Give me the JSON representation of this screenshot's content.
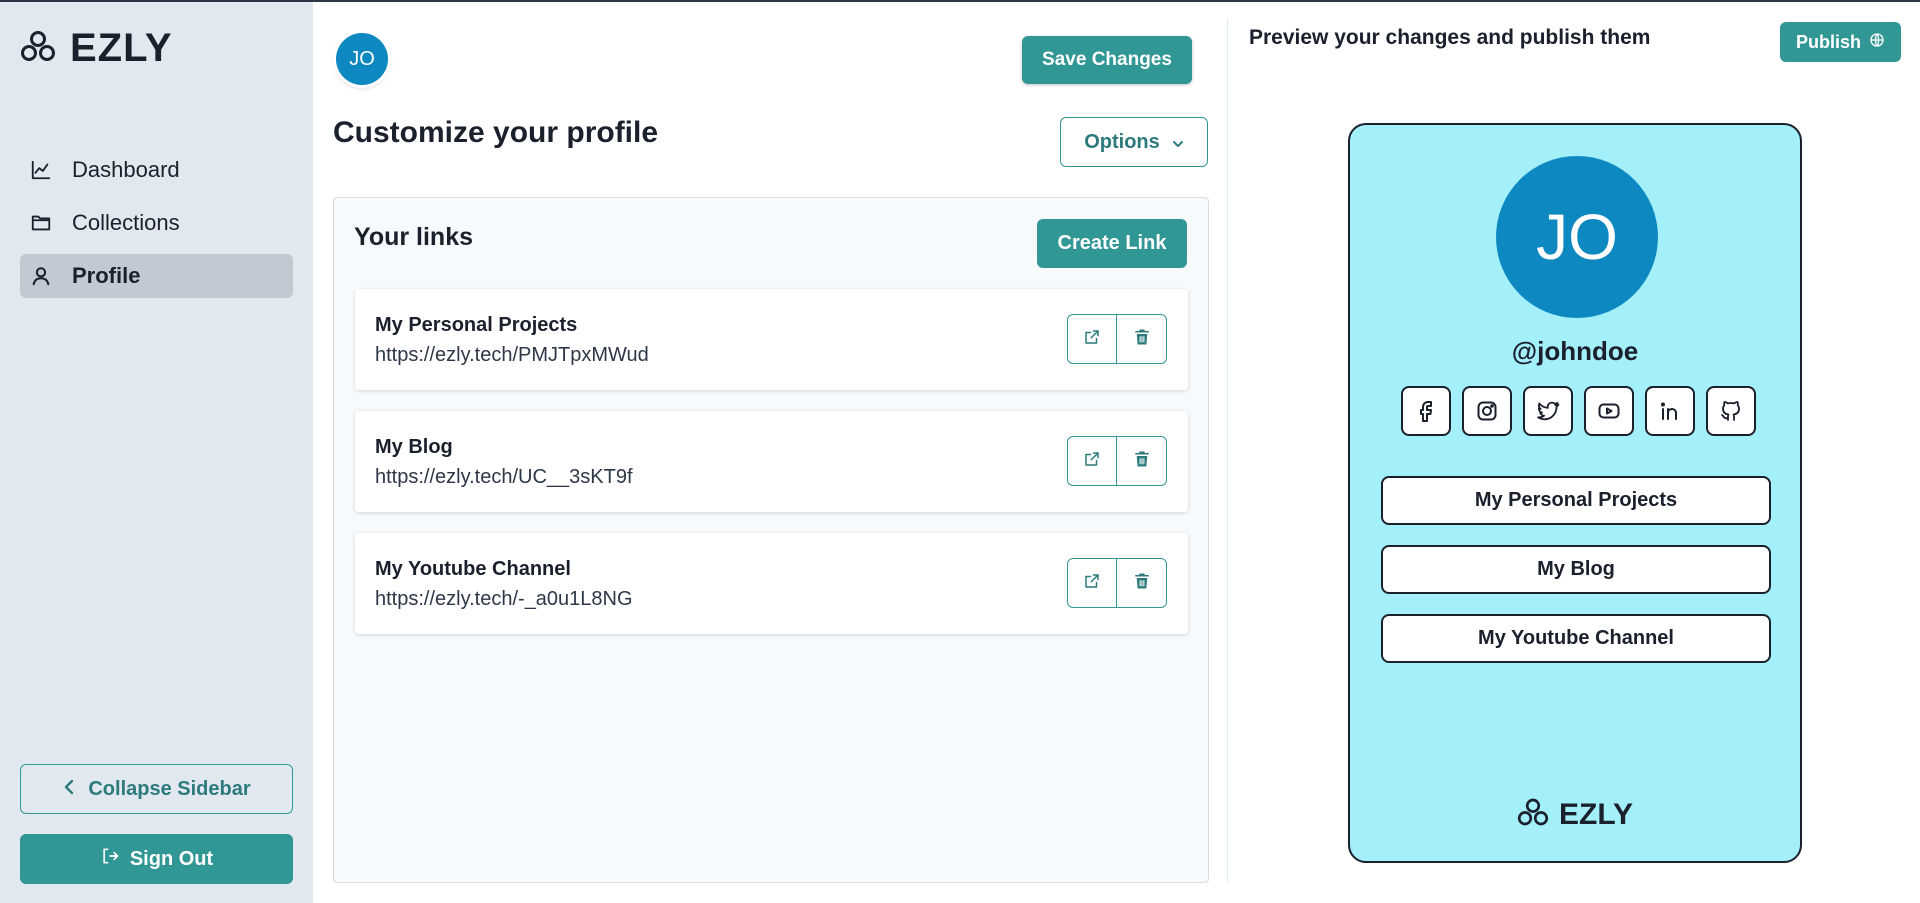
{
  "app": {
    "name": "EZLY"
  },
  "sidebar": {
    "items": [
      {
        "label": "Dashboard",
        "icon": "chart-line-icon",
        "active": false
      },
      {
        "label": "Collections",
        "icon": "folder-icon",
        "active": false
      },
      {
        "label": "Profile",
        "icon": "user-icon",
        "active": true
      }
    ],
    "collapse_label": "Collapse Sidebar",
    "signout_label": "Sign Out"
  },
  "header": {
    "avatar_initials": "JO",
    "save_label": "Save Changes"
  },
  "main": {
    "title": "Customize your profile",
    "options_label": "Options",
    "links_title": "Your links",
    "create_label": "Create Link",
    "links": [
      {
        "name": "My Personal Projects",
        "url": "https://ezly.tech/PMJTpxMWud"
      },
      {
        "name": "My Blog",
        "url": "https://ezly.tech/UC__3sKT9f"
      },
      {
        "name": "My Youtube Channel",
        "url": "https://ezly.tech/-_a0u1L8NG"
      }
    ]
  },
  "preview": {
    "title": "Preview your changes and publish them",
    "publish_label": "Publish",
    "avatar_initials": "JO",
    "handle": "@johndoe",
    "socials": [
      "facebook-icon",
      "instagram-icon",
      "twitter-icon",
      "youtube-icon",
      "linkedin-icon",
      "github-icon"
    ],
    "links": [
      "My Personal Projects",
      "My Blog",
      "My Youtube Channel"
    ],
    "brand": "EZLY"
  },
  "colors": {
    "accent": "#319795",
    "sidebar_bg": "#e2e8f0",
    "avatar_bg": "#0e88c0",
    "preview_bg": "#a3f0fb"
  }
}
